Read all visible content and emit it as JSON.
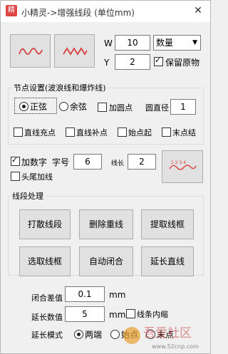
{
  "title": "小精灵->增强线段 (单位mm)",
  "close_glyph": "✕",
  "top": {
    "w_label": "W",
    "w_value": "10",
    "y_label": "Y",
    "y_value": "2",
    "mode_select": "数量",
    "keep_original": "保留原物"
  },
  "nodes": {
    "title": "节点设置(波浪线和爆炸线)",
    "radio_sine": "正弦",
    "radio_cosine": "余弦",
    "add_dots": "加圆点",
    "diameter_label": "圆直径",
    "diameter_value": "1",
    "line_fill": "直线充点",
    "line_supplement": "直线补点",
    "start_point": "始点起",
    "end_point": "末点结"
  },
  "numbering": {
    "add_number": "加数字",
    "font_size_label": "字号",
    "font_size_value": "6",
    "line_length_label": "线长",
    "line_length_value": "2",
    "add_head_tail": "头尾加线"
  },
  "processing": {
    "title": "线段处理",
    "buttons": [
      "打散线段",
      "删除重线",
      "提取线框",
      "选取线框",
      "自动闭合",
      "延长直线"
    ]
  },
  "params": {
    "closure_label": "闭合差值",
    "closure_value": "0.1",
    "closure_unit": "mm",
    "extend_label": "延长数值",
    "extend_value": "5",
    "extend_unit": "mm",
    "inner_line": "线条内缩",
    "mode_label": "延长模式",
    "mode_options": [
      "两端",
      "始点",
      "末点"
    ]
  },
  "watermark": {
    "text": "吾爱社区",
    "url": "www.52cnp.com"
  },
  "colors": {
    "wave_red": "#d94040",
    "accent": "#e04545"
  }
}
